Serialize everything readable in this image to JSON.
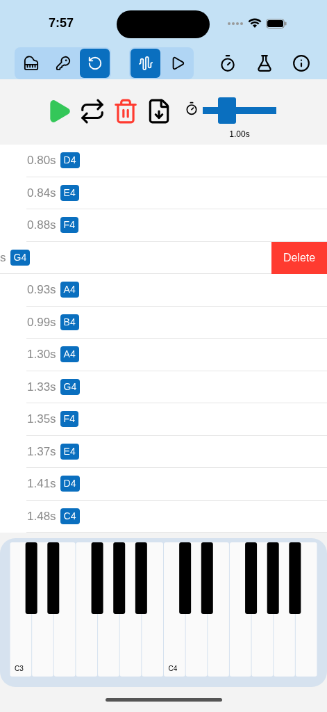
{
  "status_bar": {
    "time": "7:57"
  },
  "toolbar": {
    "groups": [
      {
        "buttons": [
          {
            "kind": "piano",
            "selected": false
          },
          {
            "kind": "key",
            "selected": false
          },
          {
            "kind": "undo",
            "selected": true
          }
        ]
      },
      {
        "buttons": [
          {
            "kind": "waveform",
            "selected": true
          },
          {
            "kind": "play",
            "selected": false
          }
        ]
      }
    ],
    "actions": [
      {
        "kind": "timer"
      },
      {
        "kind": "flask"
      },
      {
        "kind": "info"
      }
    ]
  },
  "controls": {
    "buttons": [
      {
        "kind": "play"
      },
      {
        "kind": "repeat"
      },
      {
        "kind": "trash"
      },
      {
        "kind": "export"
      }
    ],
    "slider": {
      "level": 0.28,
      "reading": "1.00s"
    }
  },
  "notes": [
    {
      "time": "0.80s",
      "note": "D4",
      "swiped": false
    },
    {
      "time": "0.84s",
      "note": "E4",
      "swiped": false
    },
    {
      "time": "0.88s",
      "note": "F4",
      "swiped": false
    },
    {
      "time": "s",
      "note": "G4",
      "swiped": true,
      "action": "Delete"
    },
    {
      "time": "0.93s",
      "note": "A4",
      "swiped": false
    },
    {
      "time": "0.99s",
      "note": "B4",
      "swiped": false
    },
    {
      "time": "1.30s",
      "note": "A4",
      "swiped": false
    },
    {
      "time": "1.33s",
      "note": "G4",
      "swiped": false
    },
    {
      "time": "1.35s",
      "note": "F4",
      "swiped": false
    },
    {
      "time": "1.37s",
      "note": "E4",
      "swiped": false
    },
    {
      "time": "1.41s",
      "note": "D4",
      "swiped": false
    },
    {
      "time": "1.48s",
      "note": "C4",
      "swiped": false
    }
  ],
  "keyboard": {
    "keys": [
      {
        "kind": "white",
        "label": "C3"
      },
      {
        "kind": "black"
      },
      {
        "kind": "white"
      },
      {
        "kind": "black"
      },
      {
        "kind": "white"
      },
      {
        "kind": "white"
      },
      {
        "kind": "black"
      },
      {
        "kind": "white"
      },
      {
        "kind": "black"
      },
      {
        "kind": "white"
      },
      {
        "kind": "black"
      },
      {
        "kind": "white"
      },
      {
        "kind": "white",
        "label": "C4"
      },
      {
        "kind": "black"
      },
      {
        "kind": "white"
      },
      {
        "kind": "black"
      },
      {
        "kind": "white"
      },
      {
        "kind": "white"
      },
      {
        "kind": "black"
      },
      {
        "kind": "white"
      },
      {
        "kind": "black"
      },
      {
        "kind": "white"
      },
      {
        "kind": "black"
      },
      {
        "kind": "white"
      }
    ]
  }
}
